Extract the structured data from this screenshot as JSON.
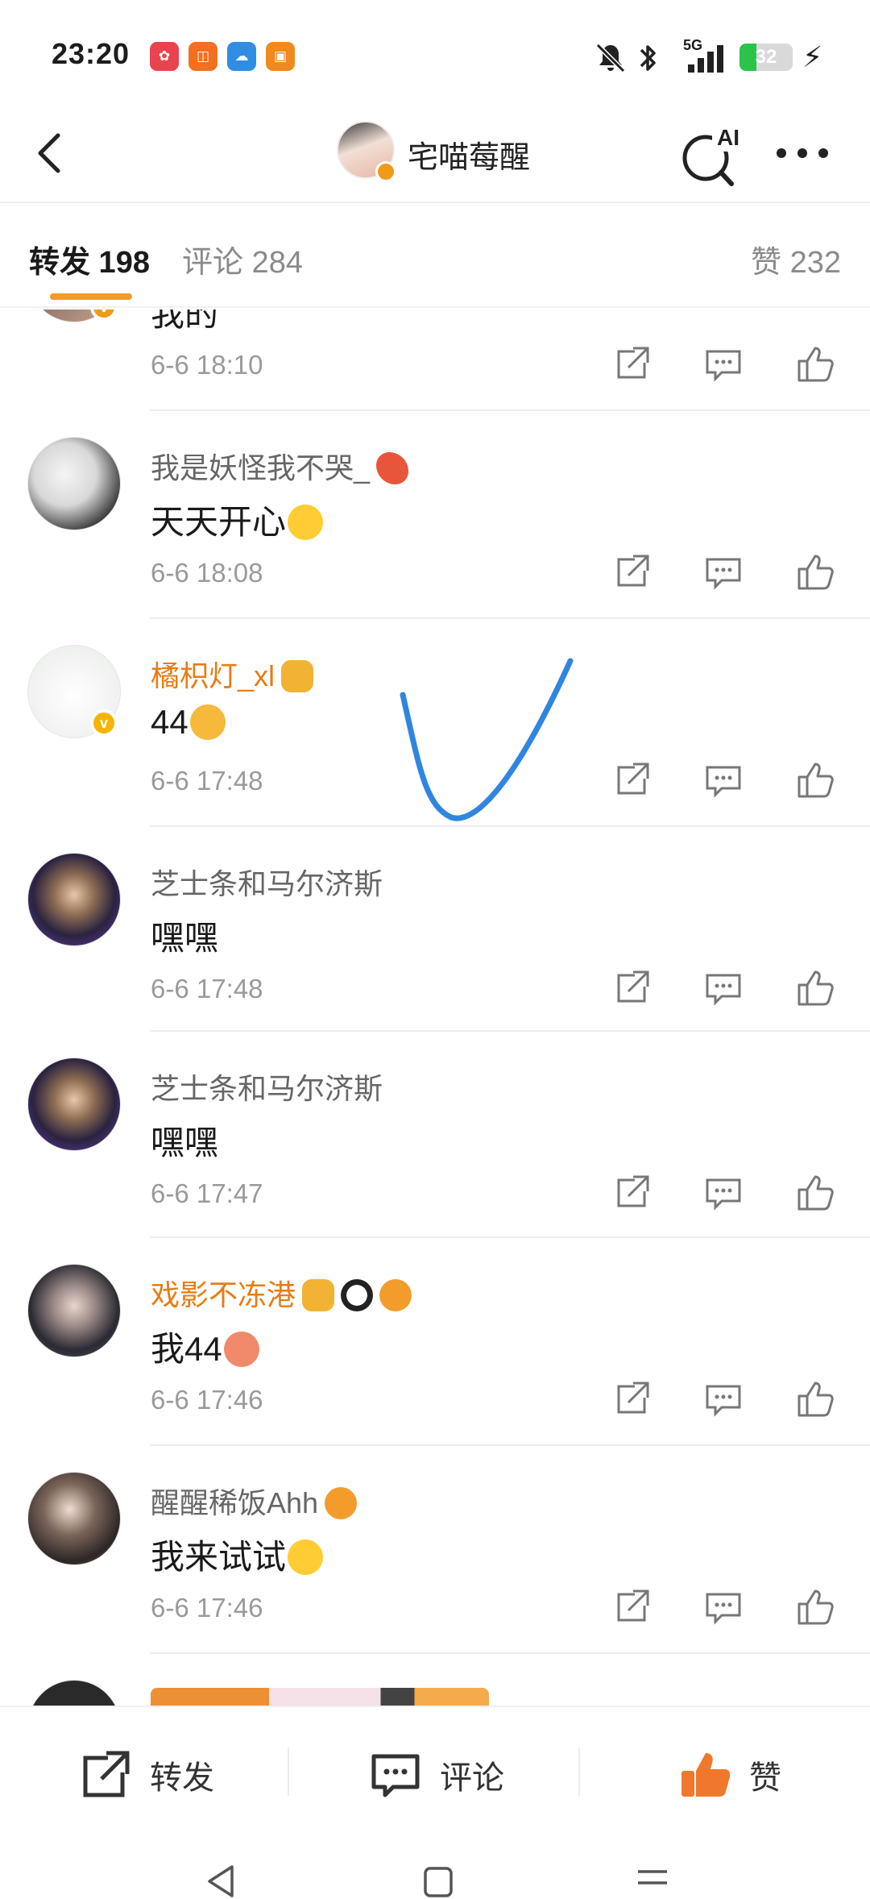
{
  "status_bar": {
    "time": "23:20",
    "network": "5G",
    "battery_level": 32,
    "battery_text": "32"
  },
  "header": {
    "title": "宅喵莓醒",
    "ai_label": "AI"
  },
  "tabs": {
    "repost": "转发 198",
    "comment": "评论 284",
    "like": "赞 232"
  },
  "feed": {
    "partial_item": {
      "content": "我的",
      "time": "6-6 18:10"
    },
    "items": [
      {
        "username": "我是妖怪我不哭_",
        "vip": false,
        "content": "天天开心",
        "time": "6-6 18:08"
      },
      {
        "username": "橘枳灯_xl",
        "vip": true,
        "content": "44",
        "time": "6-6 17:48"
      },
      {
        "username": "芝士条和马尔济斯",
        "vip": false,
        "content": "嘿嘿",
        "time": "6-6 17:48"
      },
      {
        "username": "芝士条和马尔济斯",
        "vip": false,
        "content": "嘿嘿",
        "time": "6-6 17:47"
      },
      {
        "username": "戏影不冻港",
        "vip": true,
        "content": "我44",
        "time": "6-6 17:46"
      },
      {
        "username": "醒醒稀饭Ahh",
        "vip": false,
        "content": "我来试试",
        "time": "6-6 17:46"
      }
    ]
  },
  "bottom_bar": {
    "repost": "转发",
    "comment": "评论",
    "like": "赞"
  },
  "colors": {
    "accent": "#f29b26",
    "vip_name": "#e87c13",
    "check_stroke": "#2f86e0"
  }
}
